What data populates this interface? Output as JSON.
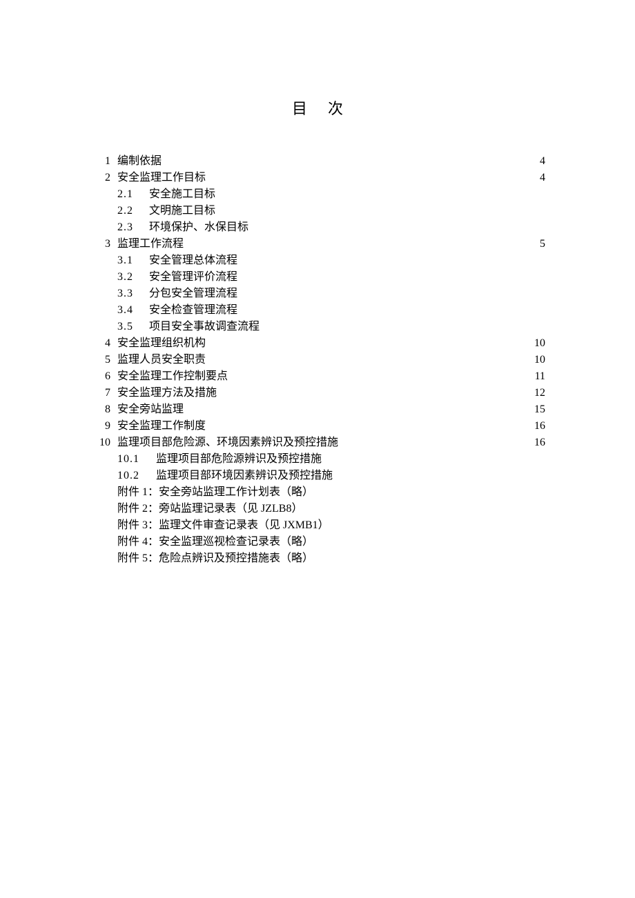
{
  "title": "目次",
  "entries": [
    {
      "num": "1",
      "label": "编制依据",
      "page": "4",
      "subs": []
    },
    {
      "num": "2",
      "label": "安全监理工作目标",
      "page": "4",
      "subs": [
        {
          "num": "2.1",
          "label": "安全施工目标"
        },
        {
          "num": "2.2",
          "label": "文明施工目标"
        },
        {
          "num": "2.3",
          "label": "环境保护、水保目标"
        }
      ]
    },
    {
      "num": "3",
      "label": "监理工作流程",
      "page": "5",
      "subs": [
        {
          "num": "3.1",
          "label": "安全管理总体流程"
        },
        {
          "num": "3.2",
          "label": "安全管理评价流程"
        },
        {
          "num": "3.3",
          "label": "分包安全管理流程"
        },
        {
          "num": "3.4",
          "label": "安全检查管理流程"
        },
        {
          "num": "3.5",
          "label": "项目安全事故调查流程"
        }
      ]
    },
    {
      "num": "4",
      "label": "安全监理组织机构",
      "page": "10",
      "subs": []
    },
    {
      "num": "5",
      "label": "监理人员安全职责",
      "page": "10",
      "subs": []
    },
    {
      "num": "6",
      "label": "安全监理工作控制要点",
      "page": "11",
      "subs": []
    },
    {
      "num": "7",
      "label": "安全监理方法及措施",
      "page": "12",
      "subs": []
    },
    {
      "num": "8",
      "label": "安全旁站监理",
      "page": "15",
      "subs": []
    },
    {
      "num": "9",
      "label": "安全监理工作制度",
      "page": "16",
      "subs": []
    },
    {
      "num": "10",
      "label": "监理项目部危险源、环境因素辨识及预控措施",
      "page": "16",
      "subs": [
        {
          "num": "10.1",
          "label": "监理项目部危险源辨识及预控措施",
          "wide": true
        },
        {
          "num": "10.2",
          "label": "监理项目部环境因素辨识及预控措施",
          "wide": true
        }
      ],
      "attachments": [
        "附件 1：安全旁站监理工作计划表（略）",
        "附件 2：旁站监理记录表（见 JZLB8）",
        "附件 3：监理文件审查记录表（见 JXMB1）",
        "附件 4：安全监理巡视检查记录表（略）",
        "附件 5：危险点辨识及预控措施表（略）"
      ]
    }
  ]
}
